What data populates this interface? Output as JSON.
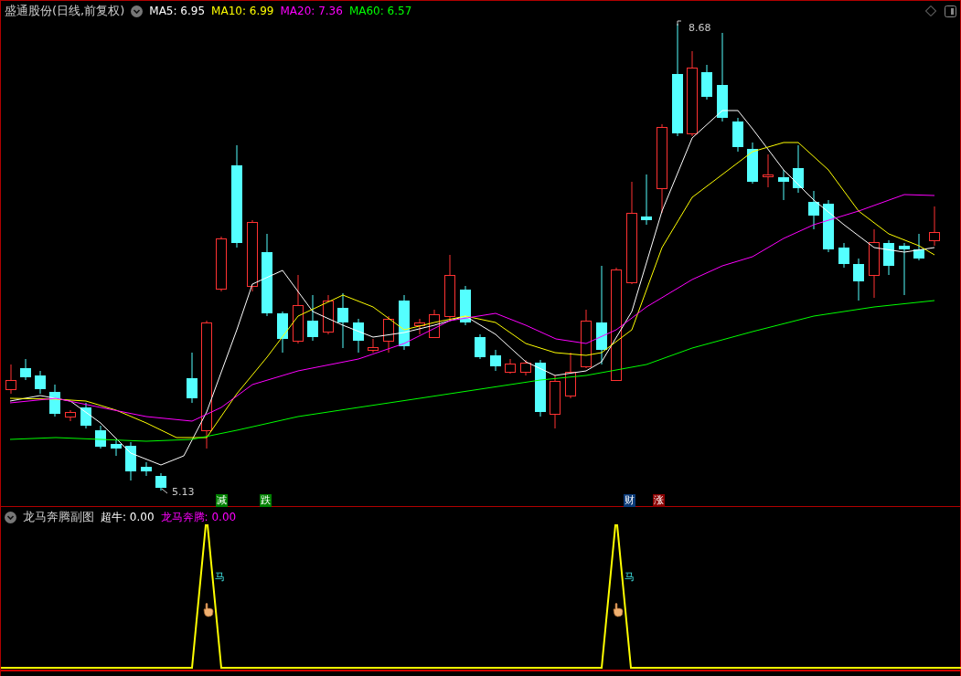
{
  "main_chart": {
    "title": "盛通股份(日线,前复权)",
    "indicators": [
      {
        "label": "MA5: 6.95",
        "color": "#ffffff"
      },
      {
        "label": "MA10: 6.99",
        "color": "#ffff00"
      },
      {
        "label": "MA20: 7.36",
        "color": "#ff00ff"
      },
      {
        "label": "MA60: 6.57",
        "color": "#00ff00"
      }
    ],
    "price_labels": {
      "high": "8.68",
      "low": "5.13"
    },
    "signals": [
      {
        "text": "减",
        "color": "#008000"
      },
      {
        "text": "跌",
        "color": "#008000"
      },
      {
        "text": "财",
        "color": "#0a3a78"
      },
      {
        "text": "涨",
        "color": "#8b0000"
      }
    ]
  },
  "sub_chart": {
    "title": "龙马奔腾副图",
    "indicators": [
      {
        "label": "超牛: 0.00",
        "color": "#ffffff"
      },
      {
        "label": "龙马奔腾: 0.00",
        "color": "#ff00ff"
      }
    ],
    "markers": [
      {
        "text": "马"
      },
      {
        "text": "马"
      }
    ]
  }
}
